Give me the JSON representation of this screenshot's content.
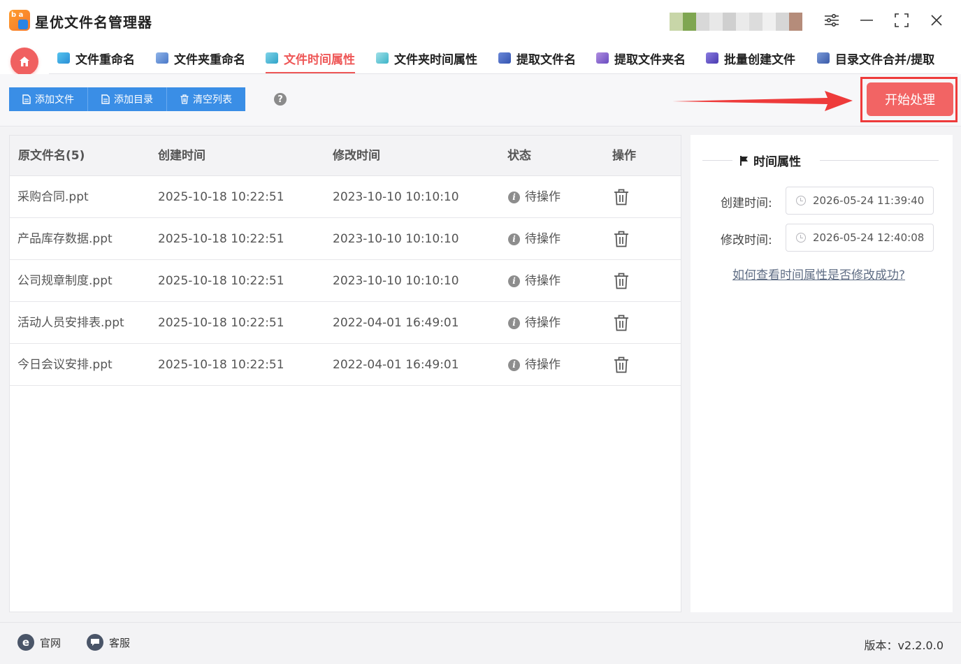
{
  "app": {
    "title": "星优文件名管理器",
    "logo_letters": "b a",
    "colors": {
      "accent": "#ee5757",
      "primary_button": "#3a8ee6",
      "start_button": "#f26464",
      "highlight_frame": "#ee3b3b",
      "arrow": "#ee3b3b"
    }
  },
  "window_controls": [
    "settings-sliders-icon",
    "minimize-icon",
    "maximize-icon",
    "close-icon"
  ],
  "tabs": [
    {
      "label": "文件重命名",
      "icon": "rename-file-icon",
      "active": false
    },
    {
      "label": "文件夹重命名",
      "icon": "rename-folder-icon",
      "active": false
    },
    {
      "label": "文件时间属性",
      "icon": "file-time-icon",
      "active": true
    },
    {
      "label": "文件夹时间属性",
      "icon": "folder-time-icon",
      "active": false
    },
    {
      "label": "提取文件名",
      "icon": "extract-filename-icon",
      "active": false
    },
    {
      "label": "提取文件夹名",
      "icon": "extract-foldername-icon",
      "active": false
    },
    {
      "label": "批量创建文件",
      "icon": "batch-create-icon",
      "active": false
    },
    {
      "label": "目录文件合并/提取",
      "icon": "merge-extract-icon",
      "active": false
    }
  ],
  "toolbar": {
    "add_file": "添加文件",
    "add_dir": "添加目录",
    "clear_list": "清空列表",
    "help": "?",
    "start": "开始处理"
  },
  "table": {
    "headers": [
      "原文件名(5)",
      "创建时间",
      "修改时间",
      "状态",
      "操作"
    ],
    "rows": [
      {
        "name": "采购合同.ppt",
        "created": "2025-10-18 10:22:51",
        "modified": "2023-10-10 10:10:10",
        "status": "待操作"
      },
      {
        "name": "产品库存数据.ppt",
        "created": "2025-10-18 10:22:51",
        "modified": "2023-10-10 10:10:10",
        "status": "待操作"
      },
      {
        "name": "公司规章制度.ppt",
        "created": "2025-10-18 10:22:51",
        "modified": "2023-10-10 10:10:10",
        "status": "待操作"
      },
      {
        "name": "活动人员安排表.ppt",
        "created": "2025-10-18 10:22:51",
        "modified": "2022-04-01 16:49:01",
        "status": "待操作"
      },
      {
        "name": "今日会议安排.ppt",
        "created": "2025-10-18 10:22:51",
        "modified": "2022-04-01 16:49:01",
        "status": "待操作"
      }
    ],
    "status_icon_glyph": "i"
  },
  "side": {
    "title": "时间属性",
    "created_label": "创建时间:",
    "created_value": "2026-05-24 11:39:40",
    "modified_label": "修改时间:",
    "modified_value": "2026-05-24 12:40:08",
    "help_link": "如何查看时间属性是否修改成功?"
  },
  "footer": {
    "website": "官网",
    "website_glyph": "e",
    "support": "客服",
    "version": "版本：v2.2.0.0"
  }
}
